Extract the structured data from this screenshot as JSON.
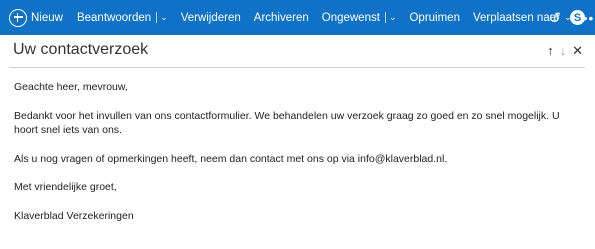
{
  "toolbar": {
    "new_label": "Nieuw",
    "reply_label": "Beantwoorden",
    "delete_label": "Verwijderen",
    "archive_label": "Archiveren",
    "junk_label": "Ongewenst",
    "sweep_label": "Opruimen",
    "move_label": "Verplaatsen naar",
    "more_label": "•••",
    "accent_color": "#0f72c6"
  },
  "message": {
    "subject": "Uw contactverzoek",
    "paragraphs": [
      "Geachte heer, mevrouw,",
      "Bedankt voor het invullen van ons contactformulier. We behandelen uw verzoek graag zo goed en zo snel mogelijk. U hoort snel iets van ons.",
      "Als u nog vragen of opmerkingen heeft, neem dan contact met ons op via info@klaverblad.nl.",
      "Met vriendelijke groet,",
      "Klaverblad Verzekeringen"
    ]
  }
}
